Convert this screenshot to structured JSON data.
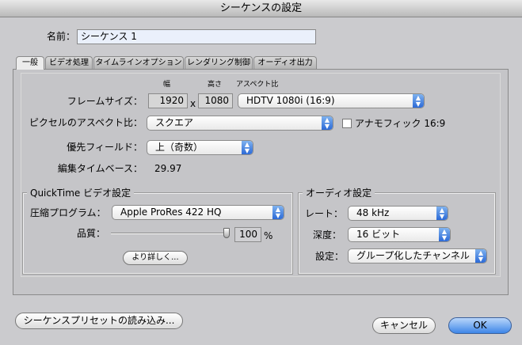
{
  "window": {
    "title": "シーケンスの設定"
  },
  "name": {
    "label": "名前：",
    "value": "シーケンス 1"
  },
  "tabs": [
    {
      "label": "一般"
    },
    {
      "label": "ビデオ処理"
    },
    {
      "label": "タイムラインオプション"
    },
    {
      "label": "レンダリング制御"
    },
    {
      "label": "オーディオ出力"
    }
  ],
  "general": {
    "col_width": "幅",
    "col_height": "高さ",
    "col_aspect": "アスペクト比",
    "frame_size_label": "フレームサイズ：",
    "width": "1920",
    "x": "x",
    "height": "1080",
    "aspect_ratio": "HDTV 1080i (16:9)",
    "pixel_aspect_label": "ピクセルのアスペクト比：",
    "pixel_aspect": "スクエア",
    "anamorphic_label": "アナモフィック 16:9",
    "anamorphic_checked": false,
    "field_dominance_label": "優先フィールド：",
    "field_dominance": "上（奇数）",
    "timebase_label": "編集タイムベース：",
    "timebase": "29.97"
  },
  "quicktime": {
    "title": "QuickTime ビデオ設定",
    "compressor_label": "圧縮プログラム：",
    "compressor": "Apple ProRes 422 HQ",
    "quality_label": "品質：",
    "quality_value": "100",
    "quality_unit": "%",
    "quality_percent": 100,
    "advanced_button": "より詳しく..."
  },
  "audio": {
    "title": "オーディオ設定",
    "rate_label": "レート：",
    "rate": "48 kHz",
    "depth_label": "深度：",
    "depth": "16 ビット",
    "config_label": "設定：",
    "config": "グループ化したチャンネル"
  },
  "footer": {
    "load_preset": "シーケンスプリセットの読み込み...",
    "cancel": "キャンセル",
    "ok": "OK"
  },
  "colors": {
    "accent": "#3d86e8"
  }
}
